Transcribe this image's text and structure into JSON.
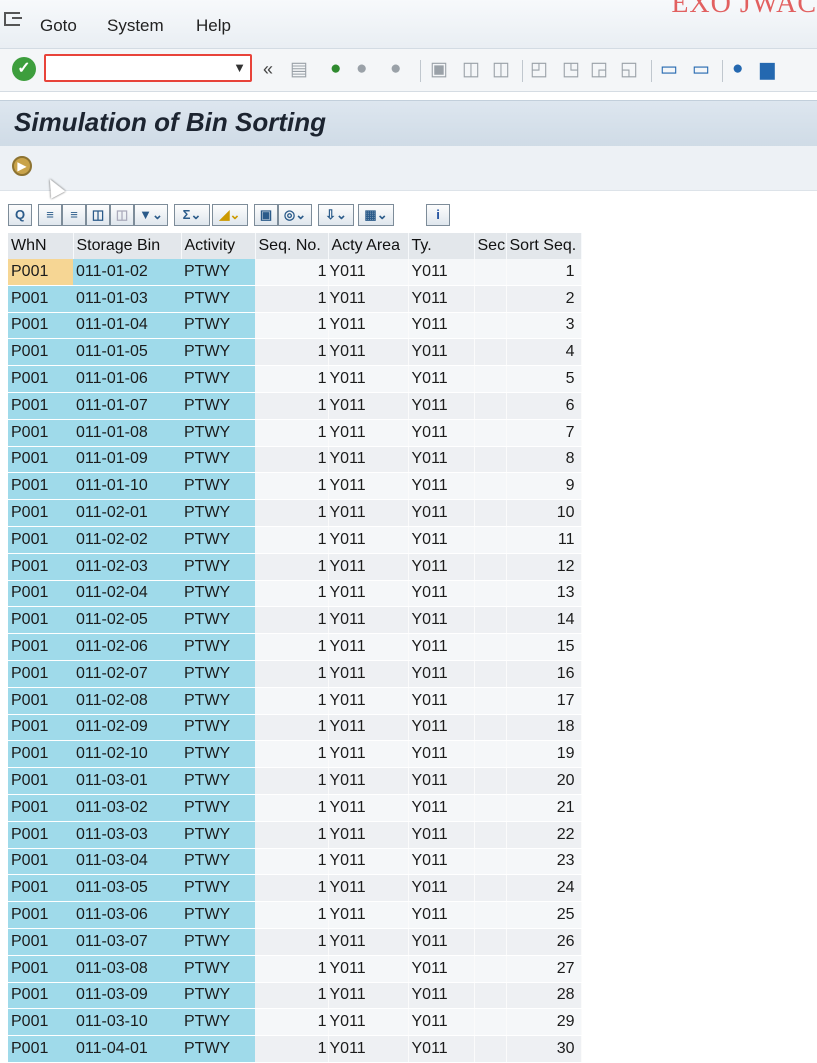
{
  "menu": {
    "items": [
      {
        "label": "Goto"
      },
      {
        "label": "System"
      },
      {
        "label": "Help"
      }
    ],
    "corner_text": "EXO JWAC"
  },
  "toolbar": {
    "command_value": "",
    "back_label": "«",
    "icons": [
      "enter-icon",
      "save-icon",
      "back-icon",
      "exit-icon",
      "cancel-icon",
      "print-icon",
      "find-icon",
      "find-next-icon",
      "first-page-icon",
      "previous-page-icon",
      "next-page-icon",
      "last-page-icon",
      "new-session-icon",
      "shortcut-icon",
      "help-icon",
      "customize-layout-icon"
    ]
  },
  "page": {
    "title": "Simulation of Bin Sorting"
  },
  "grid": {
    "columns": [
      "WhN",
      "Storage Bin",
      "Activity",
      "Seq. No.",
      "Acty Area",
      "Ty.",
      "Sec",
      "Sort Seq."
    ],
    "rows": [
      [
        "P001",
        "011-01-02",
        "PTWY",
        "1",
        "Y011",
        "Y011",
        "",
        "1"
      ],
      [
        "P001",
        "011-01-03",
        "PTWY",
        "1",
        "Y011",
        "Y011",
        "",
        "2"
      ],
      [
        "P001",
        "011-01-04",
        "PTWY",
        "1",
        "Y011",
        "Y011",
        "",
        "3"
      ],
      [
        "P001",
        "011-01-05",
        "PTWY",
        "1",
        "Y011",
        "Y011",
        "",
        "4"
      ],
      [
        "P001",
        "011-01-06",
        "PTWY",
        "1",
        "Y011",
        "Y011",
        "",
        "5"
      ],
      [
        "P001",
        "011-01-07",
        "PTWY",
        "1",
        "Y011",
        "Y011",
        "",
        "6"
      ],
      [
        "P001",
        "011-01-08",
        "PTWY",
        "1",
        "Y011",
        "Y011",
        "",
        "7"
      ],
      [
        "P001",
        "011-01-09",
        "PTWY",
        "1",
        "Y011",
        "Y011",
        "",
        "8"
      ],
      [
        "P001",
        "011-01-10",
        "PTWY",
        "1",
        "Y011",
        "Y011",
        "",
        "9"
      ],
      [
        "P001",
        "011-02-01",
        "PTWY",
        "1",
        "Y011",
        "Y011",
        "",
        "10"
      ],
      [
        "P001",
        "011-02-02",
        "PTWY",
        "1",
        "Y011",
        "Y011",
        "",
        "11"
      ],
      [
        "P001",
        "011-02-03",
        "PTWY",
        "1",
        "Y011",
        "Y011",
        "",
        "12"
      ],
      [
        "P001",
        "011-02-04",
        "PTWY",
        "1",
        "Y011",
        "Y011",
        "",
        "13"
      ],
      [
        "P001",
        "011-02-05",
        "PTWY",
        "1",
        "Y011",
        "Y011",
        "",
        "14"
      ],
      [
        "P001",
        "011-02-06",
        "PTWY",
        "1",
        "Y011",
        "Y011",
        "",
        "15"
      ],
      [
        "P001",
        "011-02-07",
        "PTWY",
        "1",
        "Y011",
        "Y011",
        "",
        "16"
      ],
      [
        "P001",
        "011-02-08",
        "PTWY",
        "1",
        "Y011",
        "Y011",
        "",
        "17"
      ],
      [
        "P001",
        "011-02-09",
        "PTWY",
        "1",
        "Y011",
        "Y011",
        "",
        "18"
      ],
      [
        "P001",
        "011-02-10",
        "PTWY",
        "1",
        "Y011",
        "Y011",
        "",
        "19"
      ],
      [
        "P001",
        "011-03-01",
        "PTWY",
        "1",
        "Y011",
        "Y011",
        "",
        "20"
      ],
      [
        "P001",
        "011-03-02",
        "PTWY",
        "1",
        "Y011",
        "Y011",
        "",
        "21"
      ],
      [
        "P001",
        "011-03-03",
        "PTWY",
        "1",
        "Y011",
        "Y011",
        "",
        "22"
      ],
      [
        "P001",
        "011-03-04",
        "PTWY",
        "1",
        "Y011",
        "Y011",
        "",
        "23"
      ],
      [
        "P001",
        "011-03-05",
        "PTWY",
        "1",
        "Y011",
        "Y011",
        "",
        "24"
      ],
      [
        "P001",
        "011-03-06",
        "PTWY",
        "1",
        "Y011",
        "Y011",
        "",
        "25"
      ],
      [
        "P001",
        "011-03-07",
        "PTWY",
        "1",
        "Y011",
        "Y011",
        "",
        "26"
      ],
      [
        "P001",
        "011-03-08",
        "PTWY",
        "1",
        "Y011",
        "Y011",
        "",
        "27"
      ],
      [
        "P001",
        "011-03-09",
        "PTWY",
        "1",
        "Y011",
        "Y011",
        "",
        "28"
      ],
      [
        "P001",
        "011-03-10",
        "PTWY",
        "1",
        "Y011",
        "Y011",
        "",
        "29"
      ],
      [
        "P001",
        "011-04-01",
        "PTWY",
        "1",
        "Y011",
        "Y011",
        "",
        "30"
      ]
    ]
  }
}
